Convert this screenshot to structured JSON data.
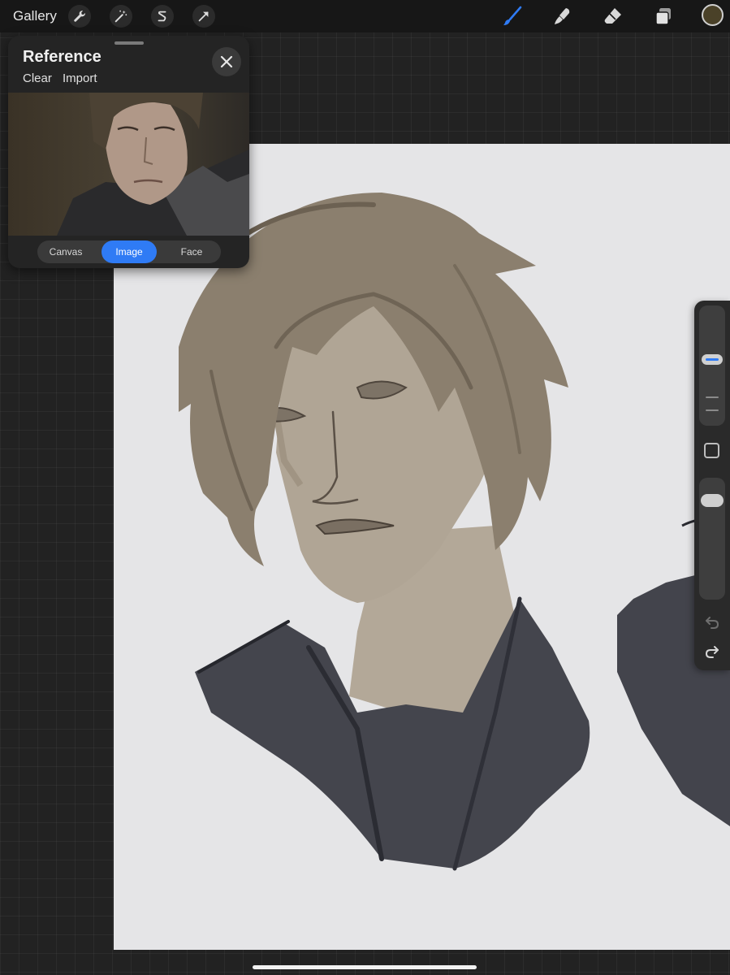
{
  "topbar": {
    "gallery_label": "Gallery",
    "left_tools": [
      {
        "icon": "wrench-icon",
        "label": "Actions"
      },
      {
        "icon": "magic-wand-icon",
        "label": "Adjustments"
      },
      {
        "icon": "selection-icon",
        "label": "Selection"
      },
      {
        "icon": "transform-arrow-icon",
        "label": "Transform"
      }
    ],
    "right_tools": [
      {
        "icon": "brush-icon",
        "active": true
      },
      {
        "icon": "smudge-icon",
        "active": false
      },
      {
        "icon": "eraser-icon",
        "active": false
      },
      {
        "icon": "layers-icon",
        "active": false
      }
    ],
    "current_color": "#4a4128",
    "active_tool_color": "#2f7bf5"
  },
  "reference": {
    "title": "Reference",
    "clear_label": "Clear",
    "import_label": "Import",
    "tabs": [
      {
        "label": "Canvas",
        "active": false
      },
      {
        "label": "Image",
        "active": true
      },
      {
        "label": "Face",
        "active": false
      }
    ]
  },
  "sidebar": {
    "brush_size_level": 0.56,
    "opacity_level": 0.9,
    "undo_icon": "undo-icon",
    "redo_icon": "redo-icon",
    "modify_icon": "modify-square-icon"
  },
  "colors": {
    "accent": "#2f7bf5",
    "canvas": "#e5e5e7",
    "hair": "#8b7f6e",
    "skin": "#a89c8b",
    "jacket": "#44454d"
  }
}
